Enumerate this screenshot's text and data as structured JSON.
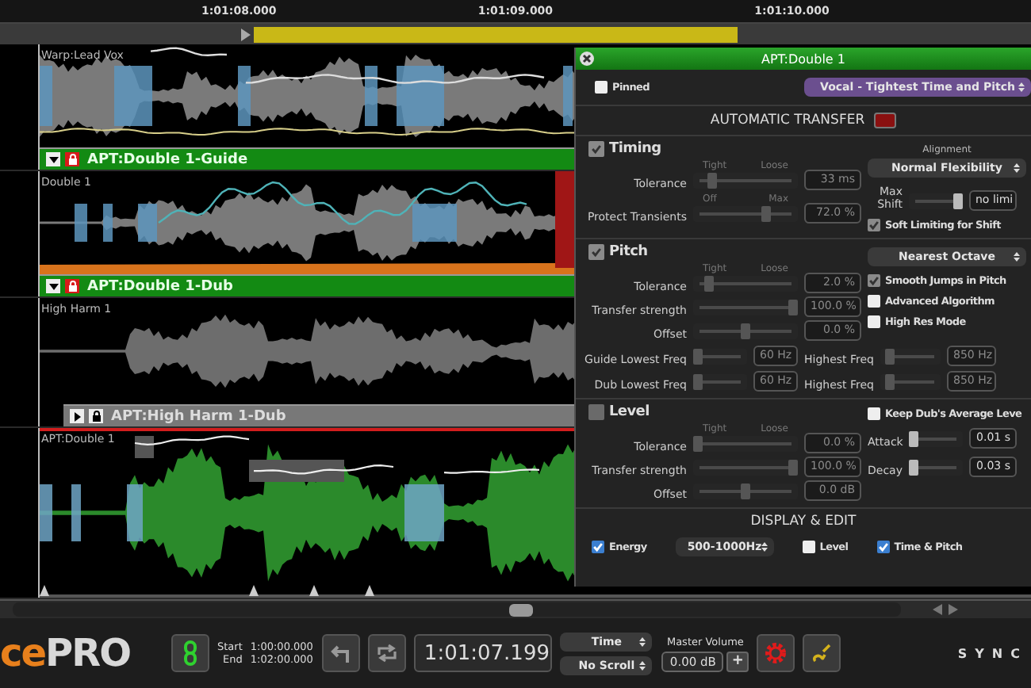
{
  "ruler": {
    "ticks": [
      "1:01:08.000",
      "1:01:09.000",
      "1:01:10.000"
    ]
  },
  "tracks": [
    {
      "name": "Warp:Lead Vox",
      "kind": "guide",
      "bar": {
        "label": "APT:Double 1-Guide",
        "active": true,
        "expanded": true,
        "locked": true
      }
    },
    {
      "name": "Double 1",
      "kind": "dub",
      "bar": {
        "label": "APT:Double 1-Dub",
        "active": true,
        "expanded": true,
        "locked": true
      }
    },
    {
      "name": "High Harm 1",
      "kind": "plain",
      "bar": {
        "label": "APT:High Harm 1-Dub",
        "active": false,
        "expanded": false,
        "locked": false
      }
    },
    {
      "name": "APT:Double 1",
      "kind": "result"
    }
  ],
  "panel": {
    "title": "APT:Double 1",
    "pinned": {
      "label": "Pinned",
      "checked": false
    },
    "preset": {
      "text": "Vocal - Tightest Time and Pitch"
    },
    "transfer": {
      "heading": "AUTOMATIC TRANSFER",
      "record_on": true
    },
    "sections": [
      {
        "title": {
          "label": "Timing",
          "checked": true
        },
        "rows": [
          {
            "label": "Tolerance",
            "min_label": "Tight",
            "max_label": "Loose",
            "level": 0.15,
            "value": "33 ms"
          },
          {
            "label": "Protect Transients",
            "min_label": "Off",
            "max_label": "Max",
            "level": 0.72,
            "value": "72.0 %"
          }
        ],
        "options": [
          {
            "kind": "caption",
            "text": "Alignment"
          },
          {
            "kind": "select",
            "text": "Normal Flexibility"
          },
          {
            "kind": "slider",
            "label": "Max Shift",
            "level": 1,
            "value": "no limi"
          },
          {
            "kind": "check",
            "label": "Soft Limiting for Shift",
            "checked": true
          }
        ]
      },
      {
        "title": {
          "label": "Pitch",
          "checked": true
        },
        "rows": [
          {
            "label": "Tolerance",
            "min_label": "Tight",
            "max_label": "Loose",
            "level": 0.12,
            "value": "2.0 %"
          },
          {
            "label": "Transfer strength",
            "level": 1,
            "value": "100.0 %"
          },
          {
            "label": "Offset",
            "level": 0.5,
            "value": "0.0 %"
          }
        ],
        "options": [
          {
            "kind": "select",
            "text": "Nearest Octave"
          },
          {
            "kind": "check",
            "label": "Smooth Jumps in Pitch",
            "checked": true
          },
          {
            "kind": "check",
            "label": "Advanced Algorithm",
            "checked": false
          },
          {
            "kind": "check",
            "label": "High Res Mode",
            "checked": false
          }
        ],
        "pairs": [
          [
            {
              "label": "Guide Lowest Freq",
              "level": 0,
              "value": "60 Hz"
            },
            {
              "label": "Highest Freq",
              "level": 0.1,
              "value": "850 Hz"
            }
          ],
          [
            {
              "label": "Dub Lowest Freq",
              "level": 0,
              "value": "60 Hz"
            },
            {
              "label": "Highest Freq",
              "level": 0.1,
              "value": "850 Hz"
            }
          ]
        ]
      },
      {
        "title": {
          "label": "Level",
          "checked": false
        },
        "rows": [
          {
            "label": "Tolerance",
            "min_label": "Tight",
            "max_label": "Loose",
            "level": 0,
            "value": "0.0 %"
          },
          {
            "label": "Transfer strength",
            "level": 1,
            "value": "100.0 %"
          },
          {
            "label": "Offset",
            "level": 0.5,
            "value": "0.0 dB"
          }
        ],
        "options": [
          {
            "kind": "check",
            "label": "Keep Dub's Average Leve",
            "checked": false
          },
          {
            "kind": "slider",
            "label": "Attack",
            "level": 0,
            "value": "0.01 s"
          },
          {
            "kind": "slider",
            "label": "Decay",
            "level": 0,
            "value": "0.03 s"
          }
        ]
      }
    ],
    "display": {
      "heading": "DISPLAY & EDIT",
      "items": [
        {
          "kind": "check",
          "label": "Energy",
          "checked": true
        },
        {
          "kind": "select",
          "text": "500-1000Hz"
        },
        {
          "kind": "check",
          "label": "Level",
          "checked": false
        },
        {
          "kind": "check",
          "label": "Time & Pitch",
          "checked": true
        }
      ]
    }
  },
  "toolbar": {
    "logo": {
      "accent": "ce",
      "main": "PRO"
    },
    "start_label": "Start",
    "start": "1:00:00.000",
    "end_label": "End",
    "end": "1:02:00.000",
    "time": "1:01:07.199",
    "mode_select": "Time",
    "scroll_select": "No Scroll",
    "volume_label": "Master Volume",
    "volume": "0.00 dB",
    "plus": "+",
    "sync": "SYNC"
  }
}
